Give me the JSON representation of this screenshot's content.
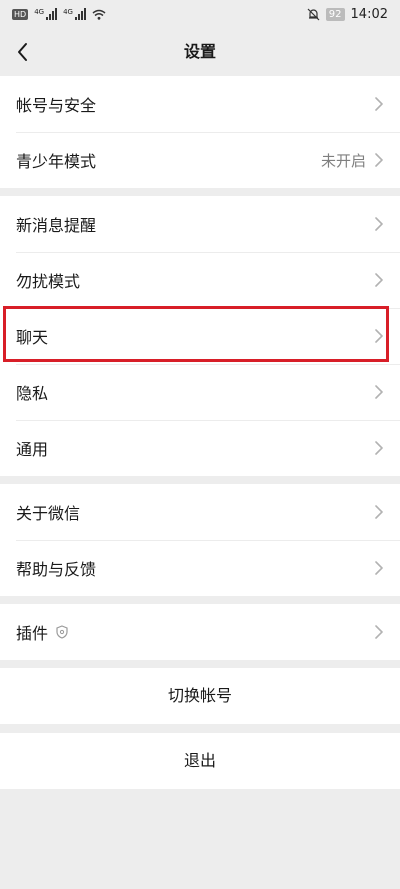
{
  "status_bar": {
    "hd_label": "HD",
    "net_1": "4G",
    "net_2": "4G",
    "battery": "92",
    "time": "14:02"
  },
  "header": {
    "title": "设置"
  },
  "groups": [
    {
      "items": [
        {
          "label": "帐号与安全"
        },
        {
          "label": "青少年模式",
          "value": "未开启"
        }
      ]
    },
    {
      "items": [
        {
          "label": "新消息提醒"
        },
        {
          "label": "勿扰模式"
        },
        {
          "label": "聊天"
        },
        {
          "label": "隐私"
        },
        {
          "label": "通用"
        }
      ]
    },
    {
      "items": [
        {
          "label": "关于微信"
        },
        {
          "label": "帮助与反馈"
        }
      ]
    },
    {
      "items": [
        {
          "label": "插件"
        }
      ]
    }
  ],
  "actions": {
    "switch_account": "切换帐号",
    "logout": "退出"
  },
  "colors": {
    "background": "#ededed",
    "highlight": "#d81e28"
  }
}
